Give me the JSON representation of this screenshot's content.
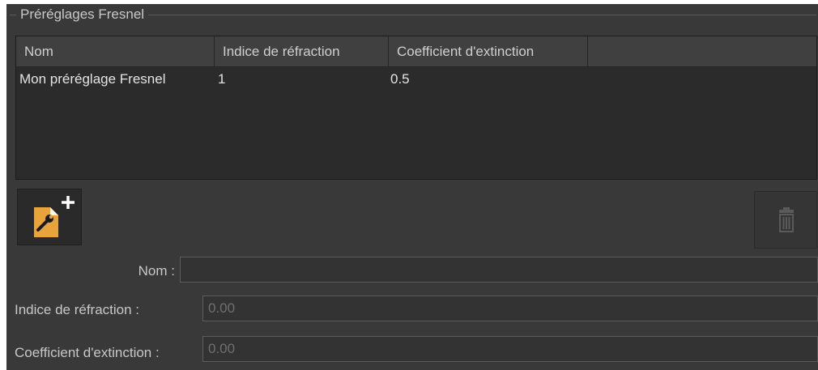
{
  "groupbox": {
    "title": "Préréglages Fresnel"
  },
  "table": {
    "columns": [
      "Nom",
      "Indice de réfraction",
      "Coefficient d'extinction",
      ""
    ],
    "rows": [
      [
        "Mon préréglage Fresnel",
        "1",
        "0.5"
      ]
    ]
  },
  "buttons": {
    "add_icon": "new-preset-icon",
    "delete_icon": "trash-icon"
  },
  "form": {
    "name_label": "Nom :",
    "name_value": "",
    "refraction_label": "Indice de réfraction :",
    "refraction_value": "0.00",
    "extinction_label": "Coefficient d'extinction :",
    "extinction_value": "0.00"
  },
  "colors": {
    "background": "#393939",
    "accent_orange": "#e8a33a"
  }
}
